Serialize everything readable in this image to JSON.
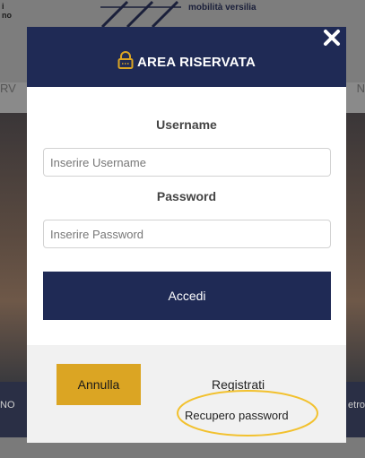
{
  "background": {
    "logo_left_line1": "i",
    "logo_left_line2": "no",
    "logo_text": "mobilità versilia",
    "nav_left": "RV",
    "nav_right": "N",
    "strip_left": "NO",
    "strip_right": "etro"
  },
  "modal": {
    "title": "AREA RISERVATA",
    "username_label": "Username",
    "username_placeholder": "Inserire Username",
    "password_label": "Password",
    "password_placeholder": "Inserire Password",
    "login_button": "Accedi",
    "cancel_button": "Annulla",
    "register_link": "Registrati",
    "recover_link": "Recupero password"
  },
  "colors": {
    "header": "#1f2a55",
    "accent": "#dba523",
    "highlight": "#f2c12e"
  },
  "icons": {
    "lock": "lock-icon",
    "close": "close-icon"
  }
}
